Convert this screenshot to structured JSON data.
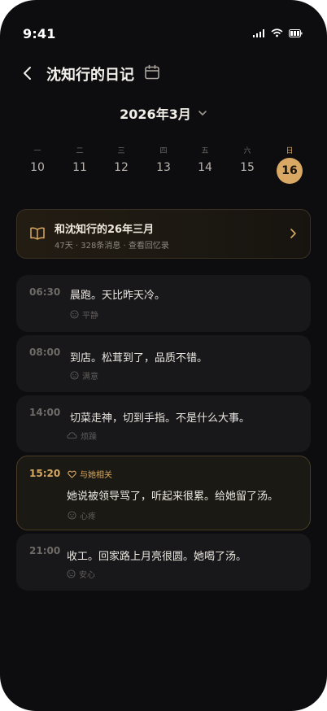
{
  "status": {
    "time": "9:41"
  },
  "header": {
    "title": "沈知行的日记"
  },
  "month": {
    "label": "2026年3月"
  },
  "week": [
    {
      "weekday": "一",
      "date": "10"
    },
    {
      "weekday": "二",
      "date": "11"
    },
    {
      "weekday": "三",
      "date": "12"
    },
    {
      "weekday": "四",
      "date": "13"
    },
    {
      "weekday": "五",
      "date": "14"
    },
    {
      "weekday": "六",
      "date": "15"
    },
    {
      "weekday": "日",
      "date": "16",
      "selected": true
    }
  ],
  "memory": {
    "title": "和沈知行的26年三月",
    "subtitle": "47天 · 328条消息 · 查看回忆录"
  },
  "entries": [
    {
      "time": "06:30",
      "text": "晨跑。天比昨天冷。",
      "mood": "平静"
    },
    {
      "time": "08:00",
      "text": "到店。松茸到了，品质不错。",
      "mood": "满意"
    },
    {
      "time": "14:00",
      "text": "切菜走神，切到手指。不是什么大事。",
      "mood": "烦躁"
    },
    {
      "time": "15:20",
      "tag": "与她相关",
      "text": "她说被领导骂了，听起来很累。给她留了汤。",
      "mood": "心疼"
    },
    {
      "time": "21:00",
      "text": "收工。回家路上月亮很圆。她喝了汤。",
      "mood": "安心"
    }
  ],
  "colors": {
    "accent": "#d9a865",
    "background": "#0d0d0f",
    "card": "#18181b"
  }
}
